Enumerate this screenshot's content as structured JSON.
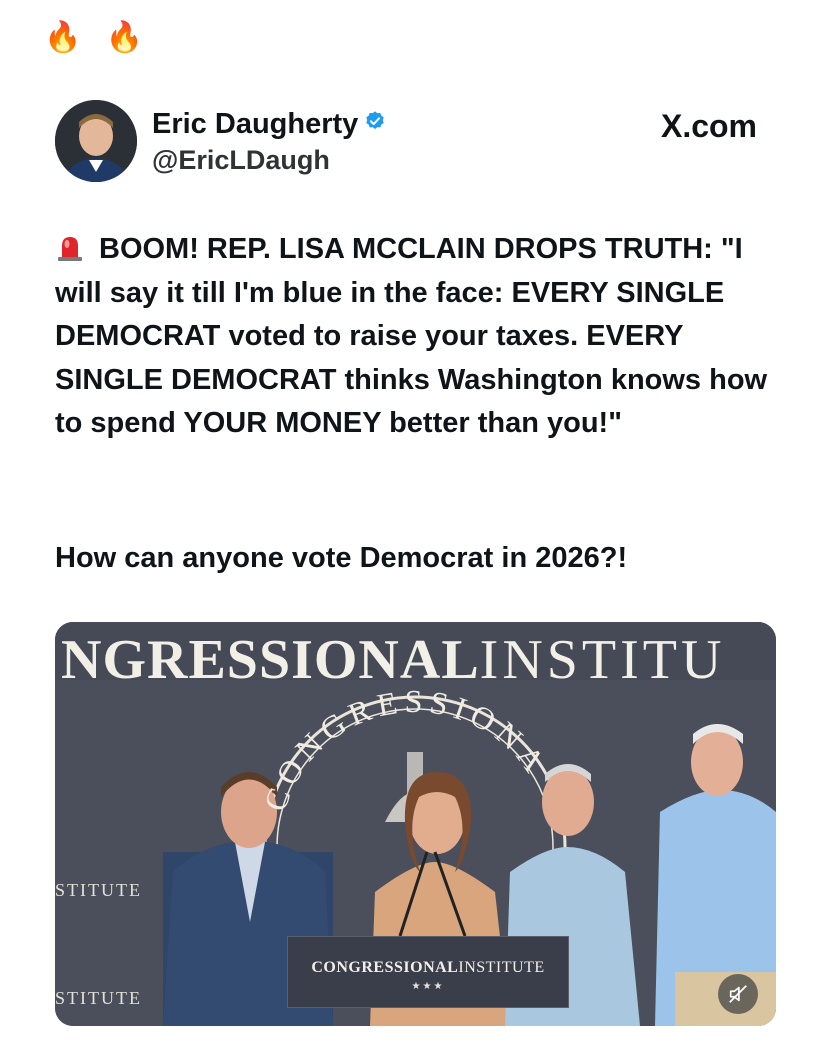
{
  "post": {
    "emoji_row": "🔥 🔥"
  },
  "tweet": {
    "display_name": "Eric Daugherty",
    "handle": "@EricLDaugh",
    "source": "X.com",
    "body": "BOOM! REP. LISA MCCLAIN DROPS TRUTH: \"I will say it till I'm blue in the face: EVERY SINGLE DEMOCRAT voted to raise your taxes. EVERY SINGLE DEMOCRAT thinks Washington knows how to spend YOUR MONEY better than you!\"",
    "question": "How can anyone vote Democrat in 2026?!",
    "icons": [
      "siren-icon",
      "verified-badge-icon",
      "mute-icon"
    ],
    "accent_color": "#1d9bf0"
  },
  "media": {
    "banner_bold": "NGRESSIONAL",
    "banner_thin": "INSTITU",
    "seal_text": "CONGRESSIONA",
    "side_label_1": "STITUTE",
    "side_label_2": "STITUTE",
    "podium_bold": "CONGRESSIONAL",
    "podium_thin": "INSTITUTE",
    "podium_stars": "★★★"
  }
}
